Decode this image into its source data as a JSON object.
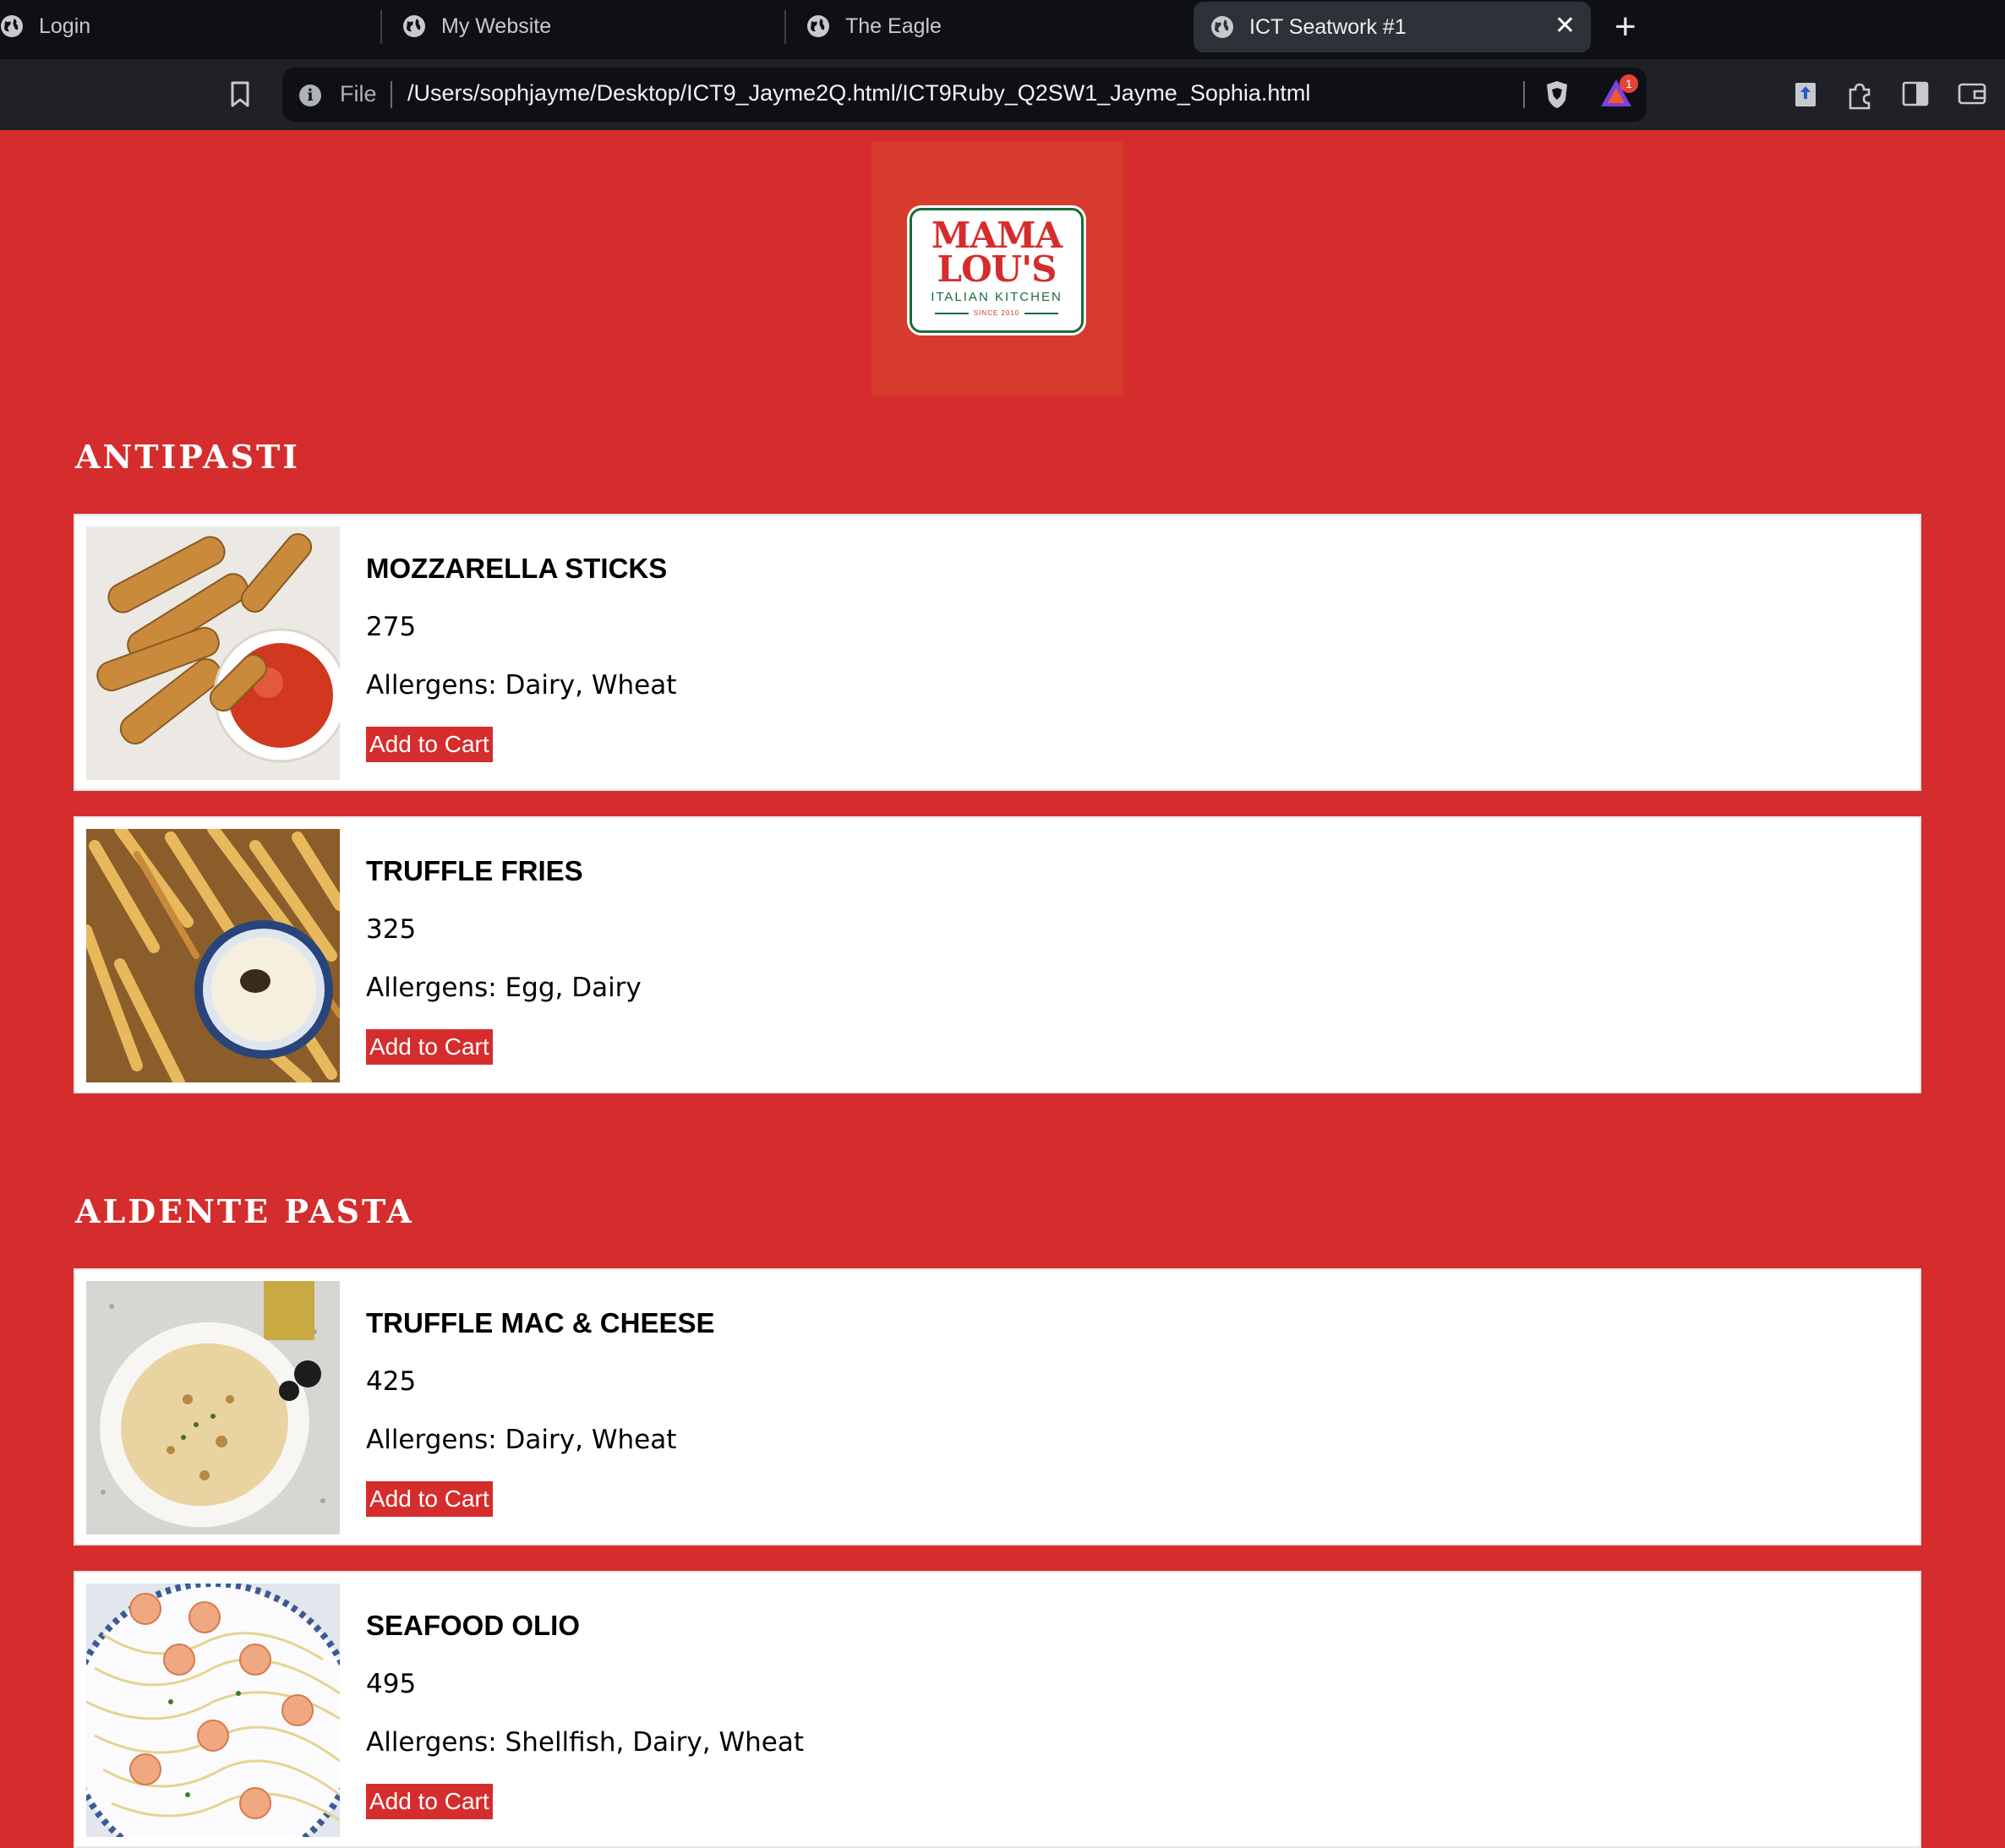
{
  "browser": {
    "tabs": [
      {
        "label": "Login"
      },
      {
        "label": "My Website"
      },
      {
        "label": "The Eagle"
      },
      {
        "label": "ICT Seatwork #1"
      }
    ],
    "close_glyph": "✕",
    "new_tab_glyph": "+",
    "file_label": "File",
    "url": "/Users/sophjayme/Desktop/ICT9_Jayme2Q.html/ICT9Ruby_Q2SW1_Jayme_Sophia.html",
    "rewards_badge": "1"
  },
  "logo": {
    "line1": "MAMA",
    "line2": "LOU'S",
    "line3": "ITALIAN KITCHEN",
    "line4": "SINCE 2010"
  },
  "sections": [
    {
      "title": "ANTIPASTI",
      "items": [
        {
          "name": "MOZZARELLA STICKS",
          "price": "275",
          "allergens": "Allergens: Dairy, Wheat",
          "button": "Add to Cart"
        },
        {
          "name": "TRUFFLE FRIES",
          "price": "325",
          "allergens": "Allergens: Egg, Dairy",
          "button": "Add to Cart"
        }
      ]
    },
    {
      "title": "ALDENTE PASTA",
      "items": [
        {
          "name": "TRUFFLE MAC & CHEESE",
          "price": "425",
          "allergens": "Allergens: Dairy, Wheat",
          "button": "Add to Cart"
        },
        {
          "name": "SEAFOOD OLIO",
          "price": "495",
          "allergens": "Allergens: Shellfish, Dairy, Wheat",
          "button": "Add to Cart"
        }
      ]
    }
  ],
  "colors": {
    "page_bg": "#d52d2d",
    "button_bg": "#d52d2d",
    "logo_green": "#1a6b3a"
  }
}
